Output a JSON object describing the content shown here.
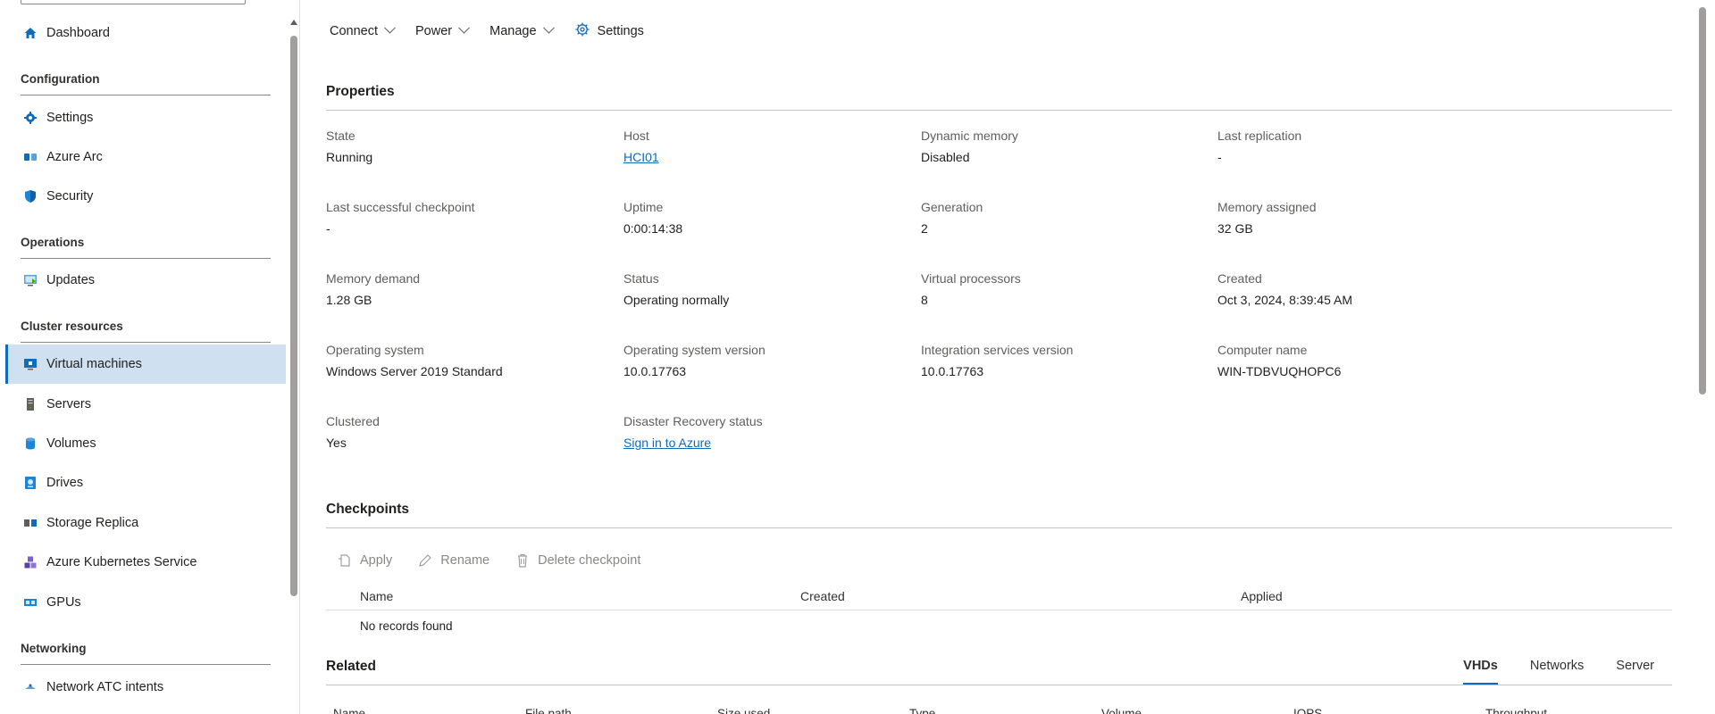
{
  "sidebar": {
    "sections": [
      {
        "title": ""
      },
      {
        "title": "Configuration"
      },
      {
        "title": "Operations"
      },
      {
        "title": "Cluster resources"
      },
      {
        "title": "Networking"
      }
    ],
    "items": [
      {
        "label": "Dashboard"
      },
      {
        "label": "Settings"
      },
      {
        "label": "Azure Arc"
      },
      {
        "label": "Security"
      },
      {
        "label": "Updates"
      },
      {
        "label": "Virtual machines"
      },
      {
        "label": "Servers"
      },
      {
        "label": "Volumes"
      },
      {
        "label": "Drives"
      },
      {
        "label": "Storage Replica"
      },
      {
        "label": "Azure Kubernetes Service"
      },
      {
        "label": "GPUs"
      },
      {
        "label": "Network ATC intents"
      }
    ]
  },
  "toolbar": {
    "connect": "Connect",
    "power": "Power",
    "manage": "Manage",
    "settings": "Settings"
  },
  "properties": {
    "title": "Properties",
    "fields": [
      {
        "label": "State",
        "value": "Running"
      },
      {
        "label": "Host",
        "value": "HCI01"
      },
      {
        "label": "Dynamic memory",
        "value": "Disabled"
      },
      {
        "label": "Last replication",
        "value": "-"
      },
      {
        "label": "Last successful checkpoint",
        "value": "-"
      },
      {
        "label": "Uptime",
        "value": "0:00:14:38"
      },
      {
        "label": "Generation",
        "value": "2"
      },
      {
        "label": "Memory assigned",
        "value": "32 GB"
      },
      {
        "label": "Memory demand",
        "value": "1.28 GB"
      },
      {
        "label": "Status",
        "value": "Operating normally"
      },
      {
        "label": "Virtual processors",
        "value": "8"
      },
      {
        "label": "Created",
        "value": "Oct 3, 2024, 8:39:45 AM"
      },
      {
        "label": "Operating system",
        "value": "Windows Server 2019 Standard"
      },
      {
        "label": "Operating system version",
        "value": "10.0.17763"
      },
      {
        "label": "Integration services version",
        "value": "10.0.17763"
      },
      {
        "label": "Computer name",
        "value": "WIN-TDBVUQHOPC6"
      },
      {
        "label": "Clustered",
        "value": "Yes"
      },
      {
        "label": "Disaster Recovery status",
        "value": "Sign in to Azure"
      }
    ]
  },
  "checkpoints": {
    "title": "Checkpoints",
    "apply": "Apply",
    "rename": "Rename",
    "delete": "Delete checkpoint",
    "columns": [
      "Name",
      "Created",
      "Applied"
    ],
    "empty": "No records found"
  },
  "related": {
    "title": "Related",
    "tabs": [
      "VHDs",
      "Networks",
      "Server"
    ],
    "columns": [
      "Name",
      "File path",
      "Size used",
      "Type",
      "Volume",
      "IOPS",
      "Throughput"
    ]
  },
  "colors": {
    "accent": "#0f6cbd",
    "active_bg": "#cfe0f1"
  }
}
